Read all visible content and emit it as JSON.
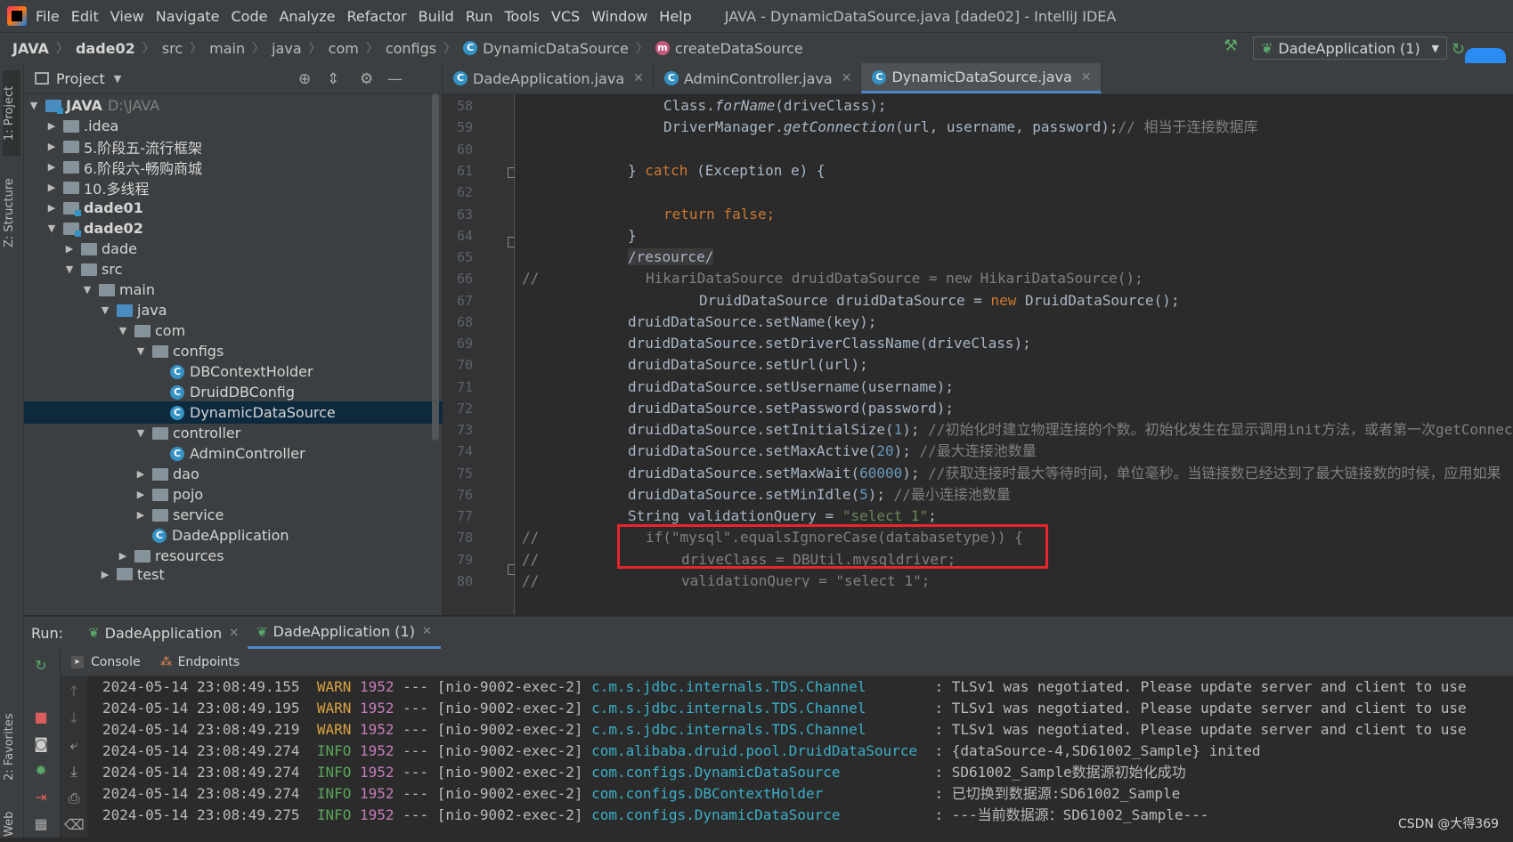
{
  "menu": {
    "items": [
      "File",
      "Edit",
      "View",
      "Navigate",
      "Code",
      "Analyze",
      "Refactor",
      "Build",
      "Run",
      "Tools",
      "VCS",
      "Window",
      "Help"
    ],
    "window_title": "JAVA - DynamicDataSource.java [dade02] - IntelliJ IDEA"
  },
  "breadcrumb": {
    "items": [
      "JAVA",
      "dade02",
      "src",
      "main",
      "java",
      "com",
      "configs",
      "DynamicDataSource",
      "createDataSource"
    ]
  },
  "run_config": {
    "label": "DadeApplication (1)"
  },
  "left_stripe": {
    "project": "1: Project",
    "structure": "Z: Structure",
    "favorites": "2: Favorites",
    "web": "Web"
  },
  "project_panel": {
    "title": "Project",
    "tree": [
      {
        "label": "JAVA",
        "path": "D:\\JAVA",
        "bold": true
      },
      {
        "label": ".idea"
      },
      {
        "label": "5.阶段五-流行框架"
      },
      {
        "label": "6.阶段六-畅购商城"
      },
      {
        "label": "10.多线程"
      },
      {
        "label": "dade01",
        "bold": true
      },
      {
        "label": "dade02",
        "bold": true
      },
      {
        "label": "dade"
      },
      {
        "label": "src"
      },
      {
        "label": "main"
      },
      {
        "label": "java"
      },
      {
        "label": "com"
      },
      {
        "label": "configs"
      },
      {
        "label": "DBContextHolder"
      },
      {
        "label": "DruidDBConfig"
      },
      {
        "label": "DynamicDataSource"
      },
      {
        "label": "controller"
      },
      {
        "label": "AdminController"
      },
      {
        "label": "dao"
      },
      {
        "label": "pojo"
      },
      {
        "label": "service"
      },
      {
        "label": "DadeApplication"
      },
      {
        "label": "resources"
      },
      {
        "label": "test"
      }
    ]
  },
  "editor_tabs": [
    {
      "label": "DadeApplication.java"
    },
    {
      "label": "AdminController.java"
    },
    {
      "label": "DynamicDataSource.java"
    }
  ],
  "code": {
    "line_numbers": [
      "58",
      "59",
      "60",
      "61",
      "62",
      "63",
      "64",
      "65",
      "66",
      "67",
      "68",
      "69",
      "70",
      "71",
      "72",
      "73",
      "74",
      "75",
      "76",
      "77",
      "78",
      "79",
      "80"
    ],
    "l58_a": "Class.",
    "l58_b": "forName",
    "l58_c": "(driveClass);",
    "l59_a": "DriverManager.",
    "l59_b": "getConnection",
    "l59_c": "(url, username, password);",
    "l59_cm": "// 相当于连接数据库",
    "l61_a": "} ",
    "l61_kw": "catch",
    "l61_b": " (Exception e) {",
    "l63_kw": "return false",
    "l63_b": ";",
    "l64": "}",
    "l65": "/resource/",
    "l66_slash": "//",
    "l66": "HikariDataSource druidDataSource = new HikariDataSource();",
    "l67_a": "DruidDataSource druidDataSource = ",
    "l67_kw": "new",
    "l67_b": " DruidDataSource();",
    "l68": "druidDataSource.setName(key);",
    "l69": "druidDataSource.setDriverClassName(driveClass);",
    "l70": "druidDataSource.setUrl(url);",
    "l71": "druidDataSource.setUsername(username);",
    "l72": "druidDataSource.setPassword(password);",
    "l73_a": "druidDataSource.setInitialSize(",
    "l73_n": "1",
    "l73_b": ");",
    "l73_cm": "//初始化时建立物理连接的个数。初始化发生在显示调用init方法，或者第一次getConnection",
    "l74_a": "druidDataSource.setMaxActive(",
    "l74_n": "20",
    "l74_b": ");",
    "l74_cm": "//最大连接池数量",
    "l75_a": "druidDataSource.setMaxWait(",
    "l75_n": "60000",
    "l75_b": ");",
    "l75_cm": "//获取连接时最大等待时间，单位毫秒。当链接数已经达到了最大链接数的时候，应用如果",
    "l76_a": "druidDataSource.setMinIdle(",
    "l76_n": "5",
    "l76_b": ");",
    "l76_cm": "//最小连接池数量",
    "l77_a": "String validationQuery = ",
    "l77_str": "\"select 1\"",
    "l77_b": ";",
    "l78_slash": "//",
    "l78": "if(\"mysql\".equalsIgnoreCase(databasetype)) {",
    "l79_slash": "//",
    "l79": "driveClass = DBUtil.mysqldriver;",
    "l80_slash": "//",
    "l80": "validationQuery = \"select 1\";"
  },
  "run_panel": {
    "label": "Run:",
    "tabs": [
      {
        "label": "DadeApplication"
      },
      {
        "label": "DadeApplication (1)"
      }
    ],
    "subtabs": [
      "Console",
      "Endpoints"
    ],
    "log": [
      {
        "ts": "2024-05-14 23:08:49.155",
        "level": "WARN",
        "pid": "1952",
        "sep": "---",
        "thread": "[nio-9002-exec-2]",
        "logger": "c.m.s.jdbc.internals.TDS.Channel",
        "msg": ": TLSv1 was negotiated. Please update server and client to use"
      },
      {
        "ts": "2024-05-14 23:08:49.195",
        "level": "WARN",
        "pid": "1952",
        "sep": "---",
        "thread": "[nio-9002-exec-2]",
        "logger": "c.m.s.jdbc.internals.TDS.Channel",
        "msg": ": TLSv1 was negotiated. Please update server and client to use"
      },
      {
        "ts": "2024-05-14 23:08:49.219",
        "level": "WARN",
        "pid": "1952",
        "sep": "---",
        "thread": "[nio-9002-exec-2]",
        "logger": "c.m.s.jdbc.internals.TDS.Channel",
        "msg": ": TLSv1 was negotiated. Please update server and client to use"
      },
      {
        "ts": "2024-05-14 23:08:49.274",
        "level": "INFO",
        "pid": "1952",
        "sep": "---",
        "thread": "[nio-9002-exec-2]",
        "logger": "com.alibaba.druid.pool.DruidDataSource",
        "msg": ": {dataSource-4,SD61002_Sample} inited"
      },
      {
        "ts": "2024-05-14 23:08:49.274",
        "level": "INFO",
        "pid": "1952",
        "sep": "---",
        "thread": "[nio-9002-exec-2]",
        "logger": "com.configs.DynamicDataSource",
        "msg": ": SD61002_Sample数据源初始化成功"
      },
      {
        "ts": "2024-05-14 23:08:49.274",
        "level": "INFO",
        "pid": "1952",
        "sep": "---",
        "thread": "[nio-9002-exec-2]",
        "logger": "com.configs.DBContextHolder",
        "msg": ": 已切换到数据源:SD61002_Sample"
      },
      {
        "ts": "2024-05-14 23:08:49.275",
        "level": "INFO",
        "pid": "1952",
        "sep": "---",
        "thread": "[nio-9002-exec-2]",
        "logger": "com.configs.DynamicDataSource",
        "msg": ": ---当前数据源：SD61002_Sample---"
      }
    ]
  },
  "watermark": "CSDN @大得369",
  "colors": {
    "accent": "#4a88c7",
    "highlight_box": "#e8262b",
    "warn": "#d9a343",
    "info": "#5aa55b"
  }
}
